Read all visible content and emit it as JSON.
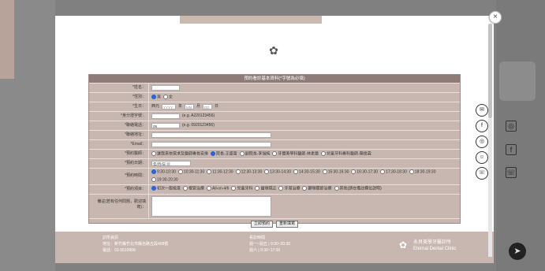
{
  "background": {
    "left_strip_color": "#b8a39a",
    "right_icons": [
      "instagram-icon",
      "share-icon",
      "phone-icon"
    ]
  },
  "modal": {
    "close_label": "×",
    "form": {
      "title": "預約看診基本資料(*字號為必填)",
      "name_label": "*姓名：",
      "gender_label": "*性別：",
      "gender_options": [
        "男",
        "女"
      ],
      "birthday_label": "*生日：",
      "birthday_prefix": "西元",
      "birthday_year_ph": "YYYY",
      "birthday_month_ph": "MM",
      "birthday_day_ph": "DD",
      "birthday_y": "年",
      "birthday_m": "月",
      "birthday_d": "日",
      "id_label": "*身分證字號：",
      "id_hint": "(e.g. A220123456)",
      "phone_label": "*聯絡電話：",
      "phone_value": "09",
      "phone_hint": "(e.g. 0920123456)",
      "address_label": "*聯絡地址：",
      "email_label": "*Email：",
      "doctor_label": "*預約醫師：",
      "doctor_options": [
        "讓我來依需求及醫師專長安排",
        "院長-王盛富",
        "副院長-李旭純",
        "牙體美學科醫師-林素蕾",
        "兒童牙科專科醫師-陳俊霖"
      ],
      "doctor_selected": 1,
      "date_label": "*預約日期：",
      "date_value": "年/月/日",
      "time_label": "*預約時間：",
      "time_options": [
        "9:30-10:30",
        "10:30-11:30",
        "11:30-12:30",
        "12:30-13:30",
        "13:30-14:30",
        "14:30-15:30",
        "15:30-16:30",
        "16:30-17:30",
        "17:30-18:30",
        "18:30-19:30",
        "19:30-20:30"
      ],
      "time_selected": 0,
      "item_label": "*預約項目：",
      "item_options": [
        "初次一般檢查",
        "根管治療",
        "All-on-4/6",
        "兒童牙科",
        "齒顎矯正",
        "牙周治療",
        "顳顎關節治療",
        "其他(請在備註欄位說明)"
      ],
      "item_selected": 0,
      "note_label": "備註(若有任何問題，歡迎填寫)：",
      "submit_label": "立即預約",
      "reset_label": "重新填寫"
    },
    "social_icons": [
      "mail-icon",
      "facebook-icon",
      "instagram-icon",
      "line-icon",
      "phone-icon"
    ],
    "footer": {
      "contact_title": "診所資訊",
      "address": "地址：新竹縣竹北市縣治路五段408號",
      "phone": "電話：03-5510999",
      "hours_title": "看診時間",
      "hours_1": "週一~週五 | 9:30~20:30",
      "hours_2": "週六 | 9:30~17:30",
      "brand_cn": "永貝美學牙醫診所",
      "brand_en": "Eternal Dental Clinic"
    }
  }
}
